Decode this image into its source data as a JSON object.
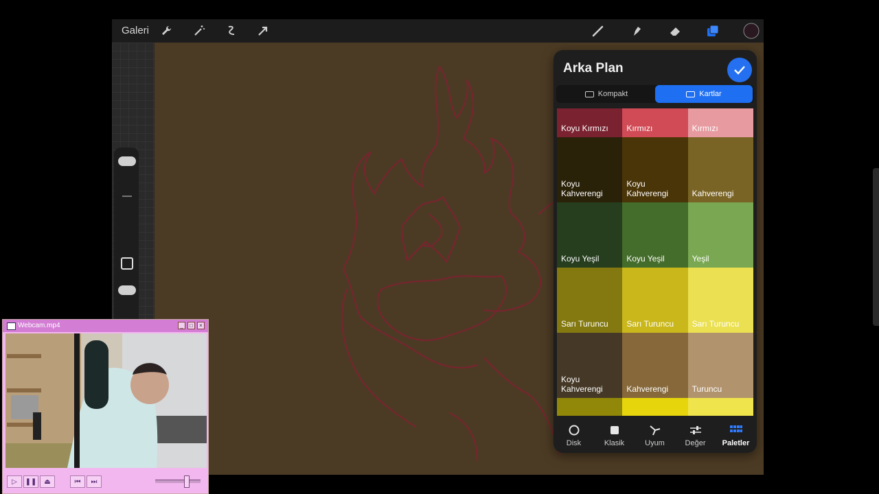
{
  "app": {
    "gallery_label": "Galeri",
    "tools_left": [
      "wrench-icon",
      "magic-wand-icon",
      "selection-icon",
      "transform-arrow-icon"
    ],
    "tools_right": [
      "brush-icon",
      "smudge-icon",
      "eraser-icon",
      "layers-icon",
      "color-icon"
    ],
    "canvas_color": "#4c3b24",
    "sketch_color": "#7a2330"
  },
  "panel": {
    "title": "Arka Plan",
    "view_modes": [
      {
        "label": "Kompakt",
        "active": false
      },
      {
        "label": "Kartlar",
        "active": true
      }
    ],
    "swatches": [
      [
        {
          "name": "Koyu Kırmızı",
          "color": "#7a2230"
        },
        {
          "name": "Kırmızı",
          "color": "#d04b55"
        },
        {
          "name": "Kırmızı",
          "color": "#e79ba0"
        }
      ],
      [
        {
          "name": "Koyu\nKahverengi",
          "color": "#2a2109"
        },
        {
          "name": "Koyu\nKahverengi",
          "color": "#4a3509"
        },
        {
          "name": "Kahverengi",
          "color": "#7a6425"
        }
      ],
      [
        {
          "name": "Koyu Yeşil",
          "color": "#263d1e"
        },
        {
          "name": "Koyu Yeşil",
          "color": "#446c2a"
        },
        {
          "name": "Yeşil",
          "color": "#7aa852"
        }
      ],
      [
        {
          "name": "Sarı Turuncu",
          "color": "#837910"
        },
        {
          "name": "Sarı Turuncu",
          "color": "#c9b71c"
        },
        {
          "name": "Sarı Turuncu",
          "color": "#ebe051"
        }
      ],
      [
        {
          "name": "Koyu\nKahverengi",
          "color": "#453826"
        },
        {
          "name": "Kahverengi",
          "color": "#86683a"
        },
        {
          "name": "Turuncu",
          "color": "#b1936d"
        }
      ],
      [
        {
          "name": "",
          "color": "#918708"
        },
        {
          "name": "",
          "color": "#e6d40c"
        },
        {
          "name": "",
          "color": "#f0e44c"
        }
      ]
    ],
    "nav": [
      {
        "label": "Disk",
        "icon": "disk-icon",
        "active": false
      },
      {
        "label": "Klasik",
        "icon": "classic-square-icon",
        "active": false
      },
      {
        "label": "Uyum",
        "icon": "harmony-icon",
        "active": false
      },
      {
        "label": "Değer",
        "icon": "value-sliders-icon",
        "active": false
      },
      {
        "label": "Paletler",
        "icon": "palettes-grid-icon",
        "active": true
      }
    ]
  },
  "webcam": {
    "title": "Webcam.mp4",
    "controls": [
      "play-icon",
      "pause-icon",
      "eject-icon",
      "previous-icon",
      "next-icon"
    ]
  }
}
